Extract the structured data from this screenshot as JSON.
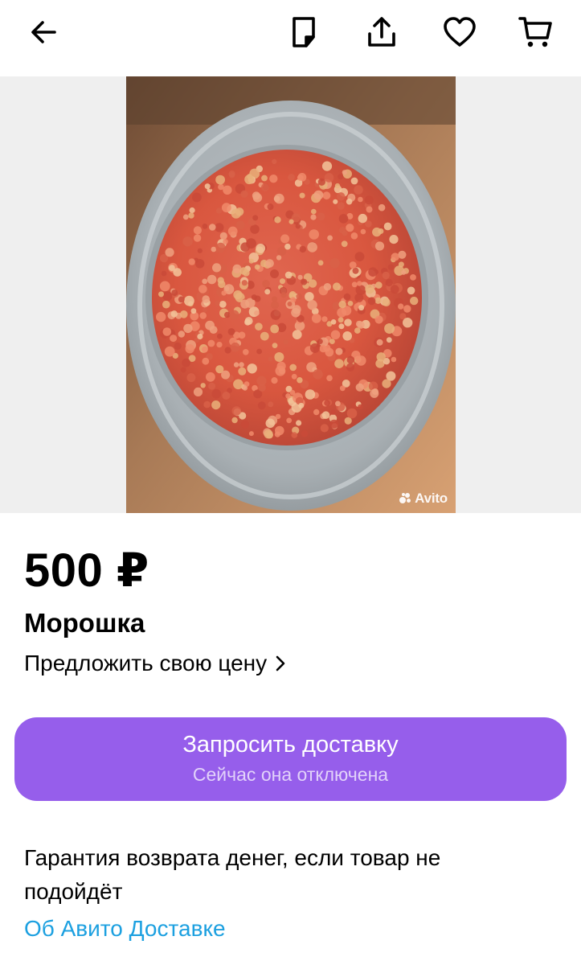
{
  "header": {
    "icons": [
      "arrow-left-icon",
      "note-icon",
      "share-icon",
      "heart-icon",
      "cart-icon"
    ]
  },
  "gallery": {
    "watermark": "Avito"
  },
  "listing": {
    "price": "500 ₽",
    "title": "Морошка",
    "offer_label": "Предложить свою цену"
  },
  "delivery": {
    "button_label": "Запросить доставку",
    "button_sub": "Сейчас она отключена",
    "guarantee_text": "Гарантия возврата денег, если товар не подойдёт",
    "about_link": "Об Авито Доставке"
  },
  "colors": {
    "accent_purple": "#965eeb",
    "link_blue": "#1ca0e0",
    "berry_red": "#e6553f"
  }
}
